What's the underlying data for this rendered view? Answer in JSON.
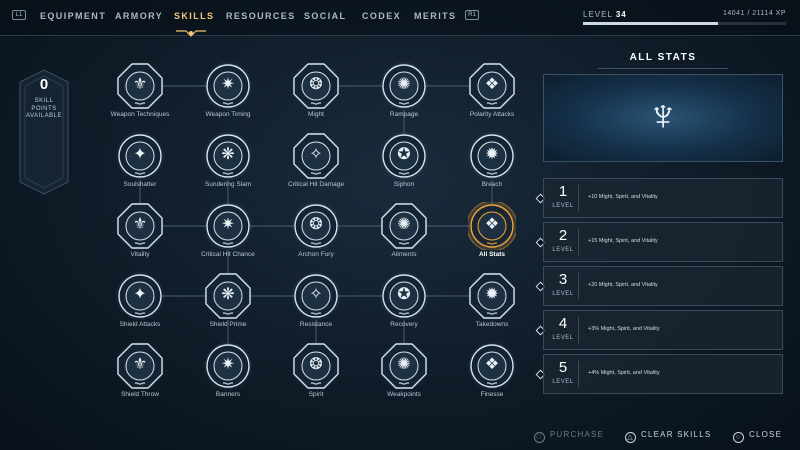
{
  "nav": {
    "left_key": "L1",
    "right_key": "R1",
    "tabs": [
      "EQUIPMENT",
      "ARMORY",
      "SKILLS",
      "RESOURCES",
      "SOCIAL",
      "CODEX",
      "MERITS"
    ],
    "active_tab": "SKILLS"
  },
  "player": {
    "level_label": "LEVEL",
    "level": "34",
    "xp_text": "14041  /  21114 XP",
    "xp_progress": 0.665
  },
  "skill_points": {
    "count": "0",
    "label_line1": "SKILL",
    "label_line2": "POINTS",
    "label_line3": "AVAILABLE"
  },
  "skills": [
    [
      "Weapon Techniques",
      "Weapon Timing",
      "Might",
      "Rampage",
      "Polarity Attacks"
    ],
    [
      "Soulshatter",
      "Sundering Slam",
      "Critical Hit Damage",
      "Siphon",
      "Breach"
    ],
    [
      "Vitality",
      "Critical Hit Chance",
      "Archon Fury",
      "Ailments",
      "All Stats"
    ],
    [
      "Shield Attacks",
      "Shield Prime",
      "Resistance",
      "Recovery",
      "Takedowns"
    ],
    [
      "Shield Throw",
      "Banners",
      "Spirit",
      "Weakpoints",
      "Finesse"
    ]
  ],
  "selected_skill": "All Stats",
  "panel": {
    "title": "ALL STATS",
    "levels": [
      {
        "num": "1",
        "word": "LEVEL",
        "desc": "+10 Might, Spirit, and Vitality"
      },
      {
        "num": "2",
        "word": "LEVEL",
        "desc": "+15 Might, Spirit, and Vitality"
      },
      {
        "num": "3",
        "word": "LEVEL",
        "desc": "+20 Might, Spirit, and Vitality"
      },
      {
        "num": "4",
        "word": "LEVEL",
        "desc": "+3% Might, Spirit, and Vitality"
      },
      {
        "num": "5",
        "word": "LEVEL",
        "desc": "+4% Might, Spirit, and Vitality"
      }
    ]
  },
  "prompts": {
    "purchase": "PURCHASE",
    "clear": "CLEAR SKILLS",
    "close": "CLOSE"
  },
  "colors": {
    "accent": "#f3c57a",
    "node_ring": "#d7e4ee",
    "selected_ring": "#f0a43c"
  }
}
